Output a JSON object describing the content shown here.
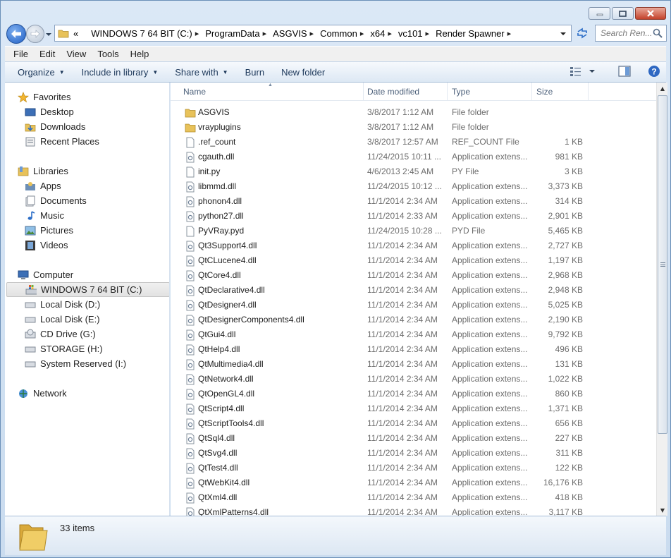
{
  "window": {
    "caption_buttons": [
      "minimize",
      "maximize",
      "close"
    ]
  },
  "address": {
    "overflow": "«",
    "crumbs": [
      "WINDOWS 7 64 BIT (C:)",
      "ProgramData",
      "ASGVIS",
      "Common",
      "x64",
      "vc101",
      "Render Spawner"
    ],
    "search_placeholder": "Search Ren..."
  },
  "menu": [
    "File",
    "Edit",
    "View",
    "Tools",
    "Help"
  ],
  "commands": {
    "organize": "Organize",
    "include": "Include in library",
    "share": "Share with",
    "burn": "Burn",
    "new_folder": "New folder"
  },
  "nav": {
    "favorites": "Favorites",
    "desktop": "Desktop",
    "downloads": "Downloads",
    "recent": "Recent Places",
    "libraries": "Libraries",
    "apps": "Apps",
    "documents": "Documents",
    "music": "Music",
    "pictures": "Pictures",
    "videos": "Videos",
    "computer": "Computer",
    "drive_c": "WINDOWS 7 64 BIT (C:)",
    "drive_d": "Local Disk (D:)",
    "drive_e": "Local Disk (E:)",
    "drive_g": "CD Drive (G:)",
    "drive_h": "STORAGE (H:)",
    "drive_i": "System Reserved (I:)",
    "network": "Network"
  },
  "columns": {
    "name": "Name",
    "date": "Date modified",
    "type": "Type",
    "size": "Size"
  },
  "files": [
    {
      "name": "ASGVIS",
      "date": "3/8/2017 1:12 AM",
      "type": "File folder",
      "size": "",
      "icon": "folder-icon"
    },
    {
      "name": "vrayplugins",
      "date": "3/8/2017 1:12 AM",
      "type": "File folder",
      "size": "",
      "icon": "folder-icon"
    },
    {
      "name": ".ref_count",
      "date": "3/8/2017 12:57 AM",
      "type": "REF_COUNT File",
      "size": "1 KB",
      "icon": "file-icon"
    },
    {
      "name": "cgauth.dll",
      "date": "11/24/2015 10:11 ...",
      "type": "Application extens...",
      "size": "981 KB",
      "icon": "dll-icon"
    },
    {
      "name": "init.py",
      "date": "4/6/2013 2:45 AM",
      "type": "PY File",
      "size": "3 KB",
      "icon": "file-icon"
    },
    {
      "name": "libmmd.dll",
      "date": "11/24/2015 10:12 ...",
      "type": "Application extens...",
      "size": "3,373 KB",
      "icon": "dll-icon"
    },
    {
      "name": "phonon4.dll",
      "date": "11/1/2014 2:34 AM",
      "type": "Application extens...",
      "size": "314 KB",
      "icon": "dll-icon"
    },
    {
      "name": "python27.dll",
      "date": "11/1/2014 2:33 AM",
      "type": "Application extens...",
      "size": "2,901 KB",
      "icon": "dll-icon"
    },
    {
      "name": "PyVRay.pyd",
      "date": "11/24/2015 10:28 ...",
      "type": "PYD File",
      "size": "5,465 KB",
      "icon": "file-icon"
    },
    {
      "name": "Qt3Support4.dll",
      "date": "11/1/2014 2:34 AM",
      "type": "Application extens...",
      "size": "2,727 KB",
      "icon": "dll-icon"
    },
    {
      "name": "QtCLucene4.dll",
      "date": "11/1/2014 2:34 AM",
      "type": "Application extens...",
      "size": "1,197 KB",
      "icon": "dll-icon"
    },
    {
      "name": "QtCore4.dll",
      "date": "11/1/2014 2:34 AM",
      "type": "Application extens...",
      "size": "2,968 KB",
      "icon": "dll-icon"
    },
    {
      "name": "QtDeclarative4.dll",
      "date": "11/1/2014 2:34 AM",
      "type": "Application extens...",
      "size": "2,948 KB",
      "icon": "dll-icon"
    },
    {
      "name": "QtDesigner4.dll",
      "date": "11/1/2014 2:34 AM",
      "type": "Application extens...",
      "size": "5,025 KB",
      "icon": "dll-icon"
    },
    {
      "name": "QtDesignerComponents4.dll",
      "date": "11/1/2014 2:34 AM",
      "type": "Application extens...",
      "size": "2,190 KB",
      "icon": "dll-icon"
    },
    {
      "name": "QtGui4.dll",
      "date": "11/1/2014 2:34 AM",
      "type": "Application extens...",
      "size": "9,792 KB",
      "icon": "dll-icon"
    },
    {
      "name": "QtHelp4.dll",
      "date": "11/1/2014 2:34 AM",
      "type": "Application extens...",
      "size": "496 KB",
      "icon": "dll-icon"
    },
    {
      "name": "QtMultimedia4.dll",
      "date": "11/1/2014 2:34 AM",
      "type": "Application extens...",
      "size": "131 KB",
      "icon": "dll-icon"
    },
    {
      "name": "QtNetwork4.dll",
      "date": "11/1/2014 2:34 AM",
      "type": "Application extens...",
      "size": "1,022 KB",
      "icon": "dll-icon"
    },
    {
      "name": "QtOpenGL4.dll",
      "date": "11/1/2014 2:34 AM",
      "type": "Application extens...",
      "size": "860 KB",
      "icon": "dll-icon"
    },
    {
      "name": "QtScript4.dll",
      "date": "11/1/2014 2:34 AM",
      "type": "Application extens...",
      "size": "1,371 KB",
      "icon": "dll-icon"
    },
    {
      "name": "QtScriptTools4.dll",
      "date": "11/1/2014 2:34 AM",
      "type": "Application extens...",
      "size": "656 KB",
      "icon": "dll-icon"
    },
    {
      "name": "QtSql4.dll",
      "date": "11/1/2014 2:34 AM",
      "type": "Application extens...",
      "size": "227 KB",
      "icon": "dll-icon"
    },
    {
      "name": "QtSvg4.dll",
      "date": "11/1/2014 2:34 AM",
      "type": "Application extens...",
      "size": "311 KB",
      "icon": "dll-icon"
    },
    {
      "name": "QtTest4.dll",
      "date": "11/1/2014 2:34 AM",
      "type": "Application extens...",
      "size": "122 KB",
      "icon": "dll-icon"
    },
    {
      "name": "QtWebKit4.dll",
      "date": "11/1/2014 2:34 AM",
      "type": "Application extens...",
      "size": "16,176 KB",
      "icon": "dll-icon"
    },
    {
      "name": "QtXml4.dll",
      "date": "11/1/2014 2:34 AM",
      "type": "Application extens...",
      "size": "418 KB",
      "icon": "dll-icon"
    },
    {
      "name": "QtXmlPatterns4.dll",
      "date": "11/1/2014 2:34 AM",
      "type": "Application extens...",
      "size": "3,117 KB",
      "icon": "dll-icon"
    }
  ],
  "status": {
    "count": "33 items"
  }
}
